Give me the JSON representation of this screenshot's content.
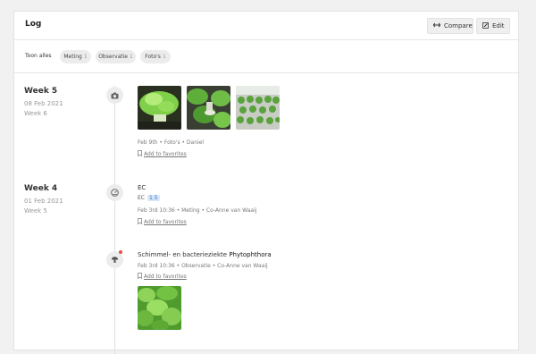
{
  "header": {
    "title": "Log",
    "compare_label": "Compare",
    "edit_label": "Edit"
  },
  "filters": {
    "all_label": "Toon alles",
    "chips": [
      {
        "label": "Meting",
        "count": "1"
      },
      {
        "label": "Observatie",
        "count": "1"
      },
      {
        "label": "Foto's",
        "count": "1"
      }
    ]
  },
  "weeks": [
    {
      "title": "Week 5",
      "date": "08 Feb 2021",
      "sub": "Week 6"
    },
    {
      "title": "Week 4",
      "date": "01 Feb 2021",
      "sub": "Week 5"
    }
  ],
  "entries": {
    "photos": {
      "meta": "Feb 9th • Foto's • Daniel",
      "fav": "Add to favorites"
    },
    "ec": {
      "title": "EC",
      "label": "EC",
      "value": "1.5",
      "meta": "Feb 3rd 10:36 • Meting • Co-Anne van Waaij",
      "fav": "Add to favorites"
    },
    "obs": {
      "title_prefix": "Schimmel- en bacterieziekte",
      "title_name": "Phytophthora",
      "meta": "Feb 3rd 10:36 • Observatie • Co-Anne van Waaij",
      "fav": "Add to favorites"
    }
  },
  "icons": [
    "arrows-icon",
    "edit-icon",
    "camera-icon",
    "gauge-icon",
    "mushroom-icon",
    "bookmark-icon"
  ]
}
